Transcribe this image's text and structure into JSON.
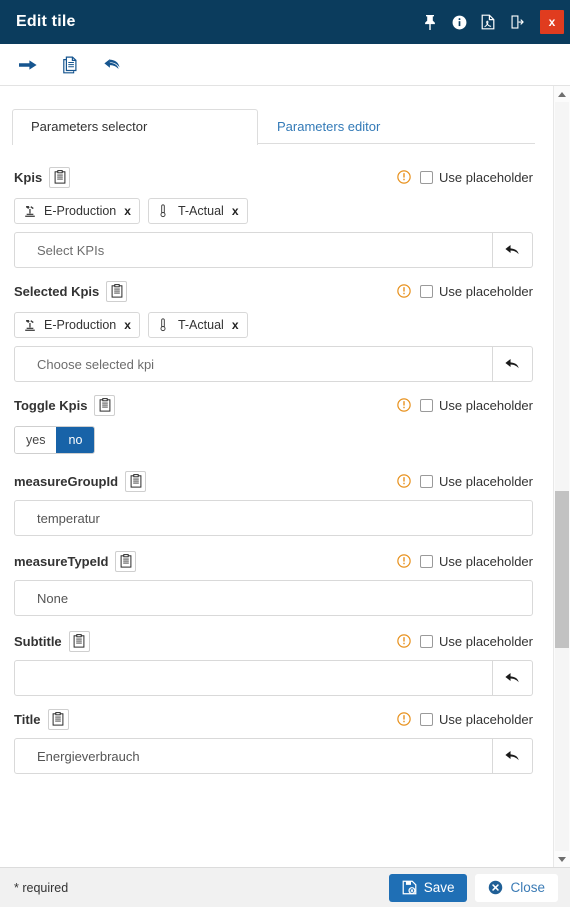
{
  "window": {
    "title": "Edit tile",
    "icons": [
      {
        "name": "pin-icon",
        "label": "Pin"
      },
      {
        "name": "info-icon",
        "label": "Info"
      },
      {
        "name": "pdf-icon",
        "label": "Export PDF"
      },
      {
        "name": "panel-toggle-icon",
        "label": "Toggle panel"
      }
    ],
    "close_label": "x"
  },
  "toolbar": {
    "items": [
      {
        "name": "arrow-right-icon",
        "label": "Next"
      },
      {
        "name": "copy-icon",
        "label": "Copy"
      },
      {
        "name": "undo-icon",
        "label": "Undo"
      }
    ]
  },
  "tabs": [
    {
      "label": "Parameters selector",
      "active": true
    },
    {
      "label": "Parameters editor",
      "active": false
    }
  ],
  "common": {
    "use_placeholder_label": "Use placeholder",
    "warning_icon": "exclamation-circle-icon",
    "clipboard_icon": "clipboard-icon",
    "undo_addon_icon": "undo-arrow-icon",
    "remove_tag_icon": "x"
  },
  "fields": {
    "kpis": {
      "label": "Kpis",
      "use_placeholder": false,
      "tags": [
        {
          "label": "E-Production",
          "icon": "machine-icon"
        },
        {
          "label": "T-Actual",
          "icon": "thermometer-icon"
        }
      ],
      "input_placeholder": "Select KPIs",
      "input_value": ""
    },
    "selected_kpis": {
      "label": "Selected Kpis",
      "use_placeholder": false,
      "tags": [
        {
          "label": "E-Production",
          "icon": "machine-icon"
        },
        {
          "label": "T-Actual",
          "icon": "thermometer-icon"
        }
      ],
      "input_placeholder": "Choose selected kpi",
      "input_value": ""
    },
    "toggle_kpis": {
      "label": "Toggle Kpis",
      "use_placeholder": false,
      "options": [
        "yes",
        "no"
      ],
      "selected": "no"
    },
    "measure_group_id": {
      "label": "measureGroupId",
      "use_placeholder": false,
      "value": "temperatur"
    },
    "measure_type_id": {
      "label": "measureTypeId",
      "use_placeholder": false,
      "value": "None"
    },
    "subtitle": {
      "label": "Subtitle",
      "use_placeholder": false,
      "value": "",
      "placeholder": ""
    },
    "title": {
      "label": "Title",
      "use_placeholder": false,
      "value": "Energieverbrauch",
      "placeholder": ""
    }
  },
  "footer": {
    "required_note": "* required",
    "save_label": "Save",
    "close_label": "Close"
  },
  "colors": {
    "titlebar": "#0b3c5d",
    "close_red": "#e03c1f",
    "accent_blue": "#1f6fb5",
    "toggle_on": "#1863a8",
    "warning_orange": "#e8921f",
    "link_blue": "#337ab7"
  },
  "scrollbar": {
    "thumb_top_pct": 52,
    "thumb_height_pct": 21
  }
}
